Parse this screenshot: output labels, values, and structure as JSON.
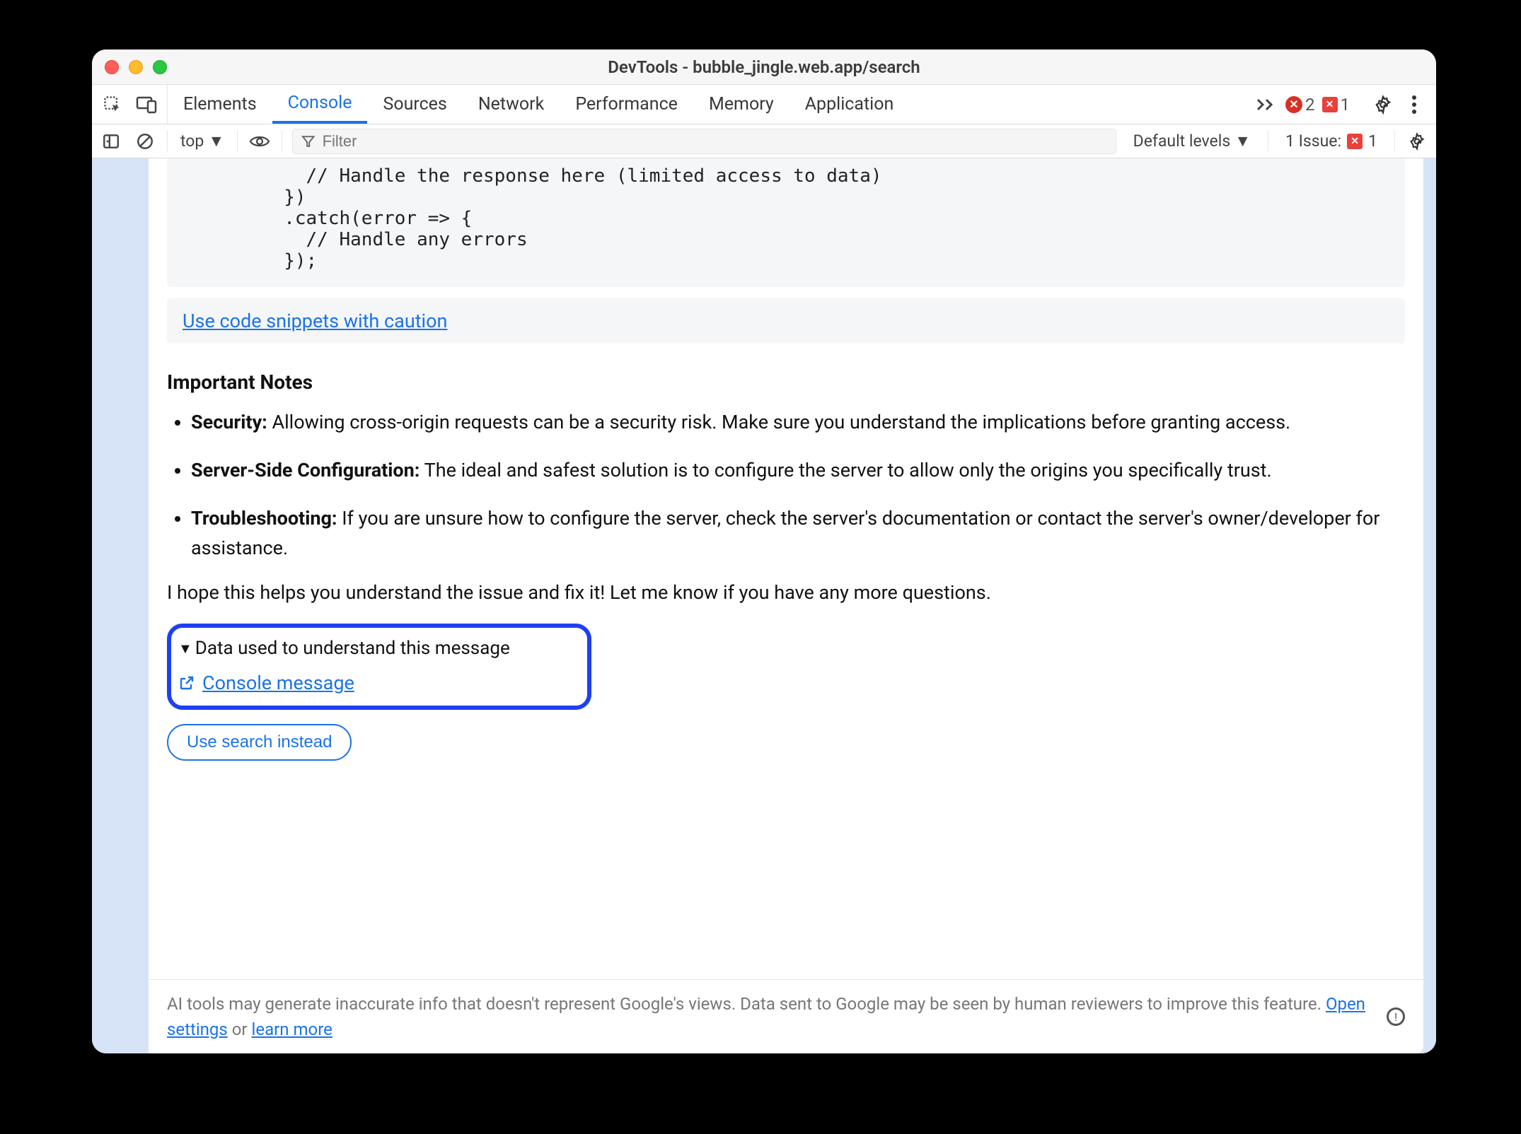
{
  "window": {
    "title": "DevTools - bubble_jingle.web.app/search"
  },
  "tabs": {
    "list": [
      "Elements",
      "Console",
      "Sources",
      "Network",
      "Performance",
      "Memory",
      "Application"
    ],
    "active": "Console",
    "error_count": "2",
    "warn_count": "1"
  },
  "console_bar": {
    "context": "top",
    "filter_placeholder": "Filter",
    "levels_label": "Default levels",
    "issues_label": "1 Issue:",
    "issues_count": "1"
  },
  "code": {
    "lines": "          // Handle the response here (limited access to data)\n        })\n        .catch(error => {\n          // Handle any errors\n        });"
  },
  "caution_link": "Use code snippets with caution",
  "notes_heading": "Important Notes",
  "notes": [
    {
      "label": "Security:",
      "text": " Allowing cross-origin requests can be a security risk. Make sure you understand the implications before granting access."
    },
    {
      "label": "Server-Side Configuration:",
      "text": " The ideal and safest solution is to configure the server to allow only the origins you specifically trust."
    },
    {
      "label": "Troubleshooting:",
      "text": " If you are unsure how to configure the server, check the server's documentation or contact the server's owner/developer for assistance."
    }
  ],
  "closing": "I hope this helps you understand the issue and fix it! Let me know if you have any more questions.",
  "highlight": {
    "summary": "Data used to understand this message",
    "console_message_link": "Console message"
  },
  "search_btn": "Use search instead",
  "footer": {
    "text_a": "AI tools may generate inaccurate info that doesn't represent Google's views. Data sent to Google may be seen by human reviewers to improve this feature. ",
    "open_settings": "Open settings",
    "or": " or ",
    "learn_more": "learn more"
  }
}
